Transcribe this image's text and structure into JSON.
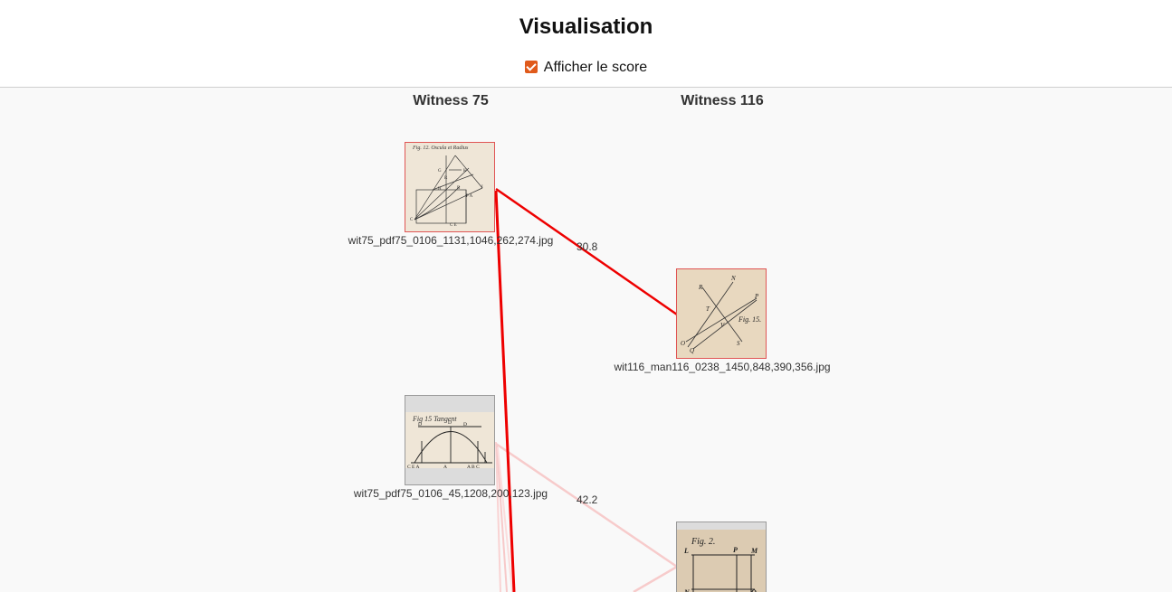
{
  "page": {
    "title": "Visualisation"
  },
  "controls": {
    "show_score_label": "Afficher le score",
    "show_score_checked": true
  },
  "columns": [
    {
      "label": "Witness 75"
    },
    {
      "label": "Witness 116"
    }
  ],
  "images": [
    {
      "filename": "wit75_pdf75_0106_1131,1046,262,274.jpg",
      "selected": true,
      "fig_label": "Fig. 12. Oscula et Radius",
      "letters": "H G R K I P A B E L C F"
    },
    {
      "filename": "wit116_man116_0238_1450,848,390,356.jpg",
      "selected": true,
      "fig_label": "Fig. 15.",
      "letters": "R N P T V O Q S"
    },
    {
      "filename": "wit75_pdf75_0106_45,1208,200,123.jpg",
      "selected": false,
      "fig_label": "Fig 15 Tangent",
      "letters": "D D D C E A A A B C"
    },
    {
      "filename": "",
      "selected": false,
      "fig_label": "Fig. 2.",
      "letters": "L P M N O"
    }
  ],
  "edges": [
    {
      "score": "30.8",
      "from": "wit75_pdf75_0106_1131,1046,262,274.jpg",
      "to": "wit116_man116_0238_1450,848,390,356.jpg",
      "strength": "strong"
    },
    {
      "score": "42.2",
      "from": "wit75_pdf75_0106_45,1208,200,123.jpg",
      "to": "",
      "strength": "weak"
    }
  ],
  "colors": {
    "accent": "#e05a1b",
    "edge_strong": "#ee0000",
    "edge_weak": "#f7c6c6",
    "background": "#f9f9f9"
  }
}
